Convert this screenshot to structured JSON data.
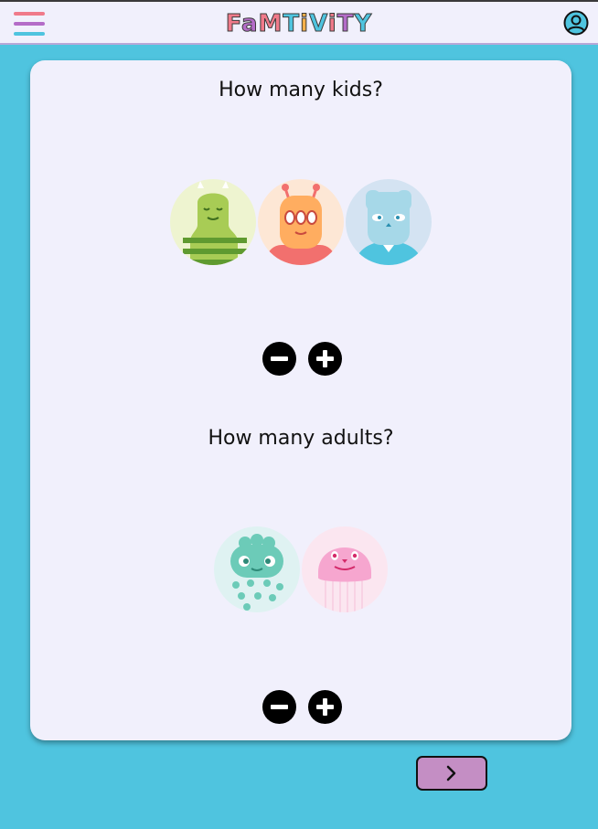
{
  "header": {
    "logo_letters": [
      "F",
      "a",
      "M",
      "T",
      "i",
      "V",
      "i",
      "T",
      "Y"
    ],
    "logo_colors": [
      "#f07a8a",
      "#b46cc8",
      "#f07a8a",
      "#4fc4df",
      "#f5b04a",
      "#4fc4df",
      "#f07a8a",
      "#b46cc8",
      "#4fc4df"
    ],
    "menu_icon": "hamburger-icon",
    "account_icon": "user-circle-icon",
    "menu_colors": [
      "#f07a8a",
      "#b46cc8",
      "#4fc4df"
    ]
  },
  "kids": {
    "question": "How many kids?",
    "count": 3,
    "avatars": [
      "green-striped-monster",
      "orange-antenna-monster",
      "blue-tie-monster"
    ],
    "decrement_icon": "minus-circle-icon",
    "increment_icon": "plus-circle-icon"
  },
  "adults": {
    "question": "How many adults?",
    "count": 2,
    "avatars": [
      "teal-spotted-monster",
      "pink-jelly-monster"
    ],
    "decrement_icon": "minus-circle-icon",
    "increment_icon": "plus-circle-icon"
  },
  "footer": {
    "next_icon": "chevron-right-icon"
  },
  "colors": {
    "background": "#4fc4df",
    "card": "#f1f0fc",
    "next_button": "#c48ec4"
  }
}
